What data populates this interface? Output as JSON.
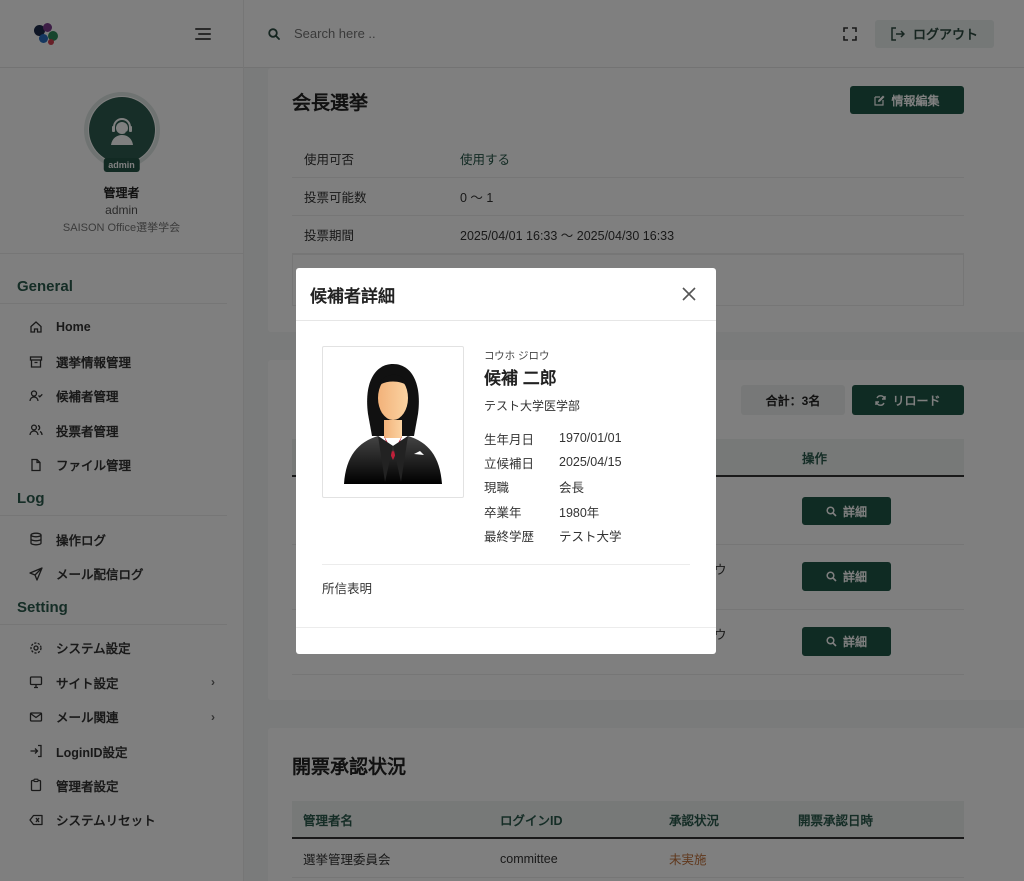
{
  "header": {
    "search_placeholder": "Search here ..",
    "logout_label": "ログアウト"
  },
  "profile": {
    "badge": "admin",
    "name": "管理者",
    "login_id": "admin",
    "org": "SAISON Office選挙学会"
  },
  "sidebar": {
    "sections": [
      {
        "title": "General",
        "items": [
          "Home",
          "選挙情報管理",
          "候補者管理",
          "投票者管理",
          "ファイル管理"
        ]
      },
      {
        "title": "Log",
        "items": [
          "操作ログ",
          "メール配信ログ"
        ]
      },
      {
        "title": "Setting",
        "items": [
          "システム設定",
          "サイト設定",
          "メール関連",
          "LoginID設定",
          "管理者設定",
          "システムリセット"
        ]
      }
    ]
  },
  "election": {
    "title": "会長選挙",
    "edit_label": "情報編集",
    "rows": [
      {
        "key": "使用可否",
        "value": "使用する"
      },
      {
        "key": "投票可能数",
        "value": "0 〜 1"
      },
      {
        "key": "投票期間",
        "value": "2025/04/01 16:33 〜 2025/04/30 16:33"
      }
    ]
  },
  "candidates": {
    "total_label": "合計：3名",
    "reload_label": "リロード",
    "col_action": "操作",
    "detail_label": "詳細",
    "row_fragment": "ウ"
  },
  "approval": {
    "title": "開票承認状況",
    "headers": [
      "管理者名",
      "ログインID",
      "承認状況",
      "開票承認日時"
    ],
    "rows": [
      {
        "name": "選挙管理委員会",
        "login_id": "committee",
        "status": "未実施",
        "date": ""
      }
    ],
    "status_color": "#c0703a"
  },
  "modal": {
    "title": "候補者詳細",
    "kana": "コウホ ジロウ",
    "name": "候補 二郎",
    "school": "テスト大学医学部",
    "details": [
      {
        "key": "生年月日",
        "value": "1970/01/01"
      },
      {
        "key": "立候補日",
        "value": "2025/04/15"
      },
      {
        "key": "現職",
        "value": "会長"
      },
      {
        "key": "卒業年",
        "value": "1980年"
      },
      {
        "key": "最終学歴",
        "value": "テスト大学"
      }
    ],
    "statement_label": "所信表明"
  },
  "colors": {
    "accent": "#1e5646",
    "section_title": "#2b5a4d",
    "overlay": "rgba(0,0,0,0.5)"
  }
}
